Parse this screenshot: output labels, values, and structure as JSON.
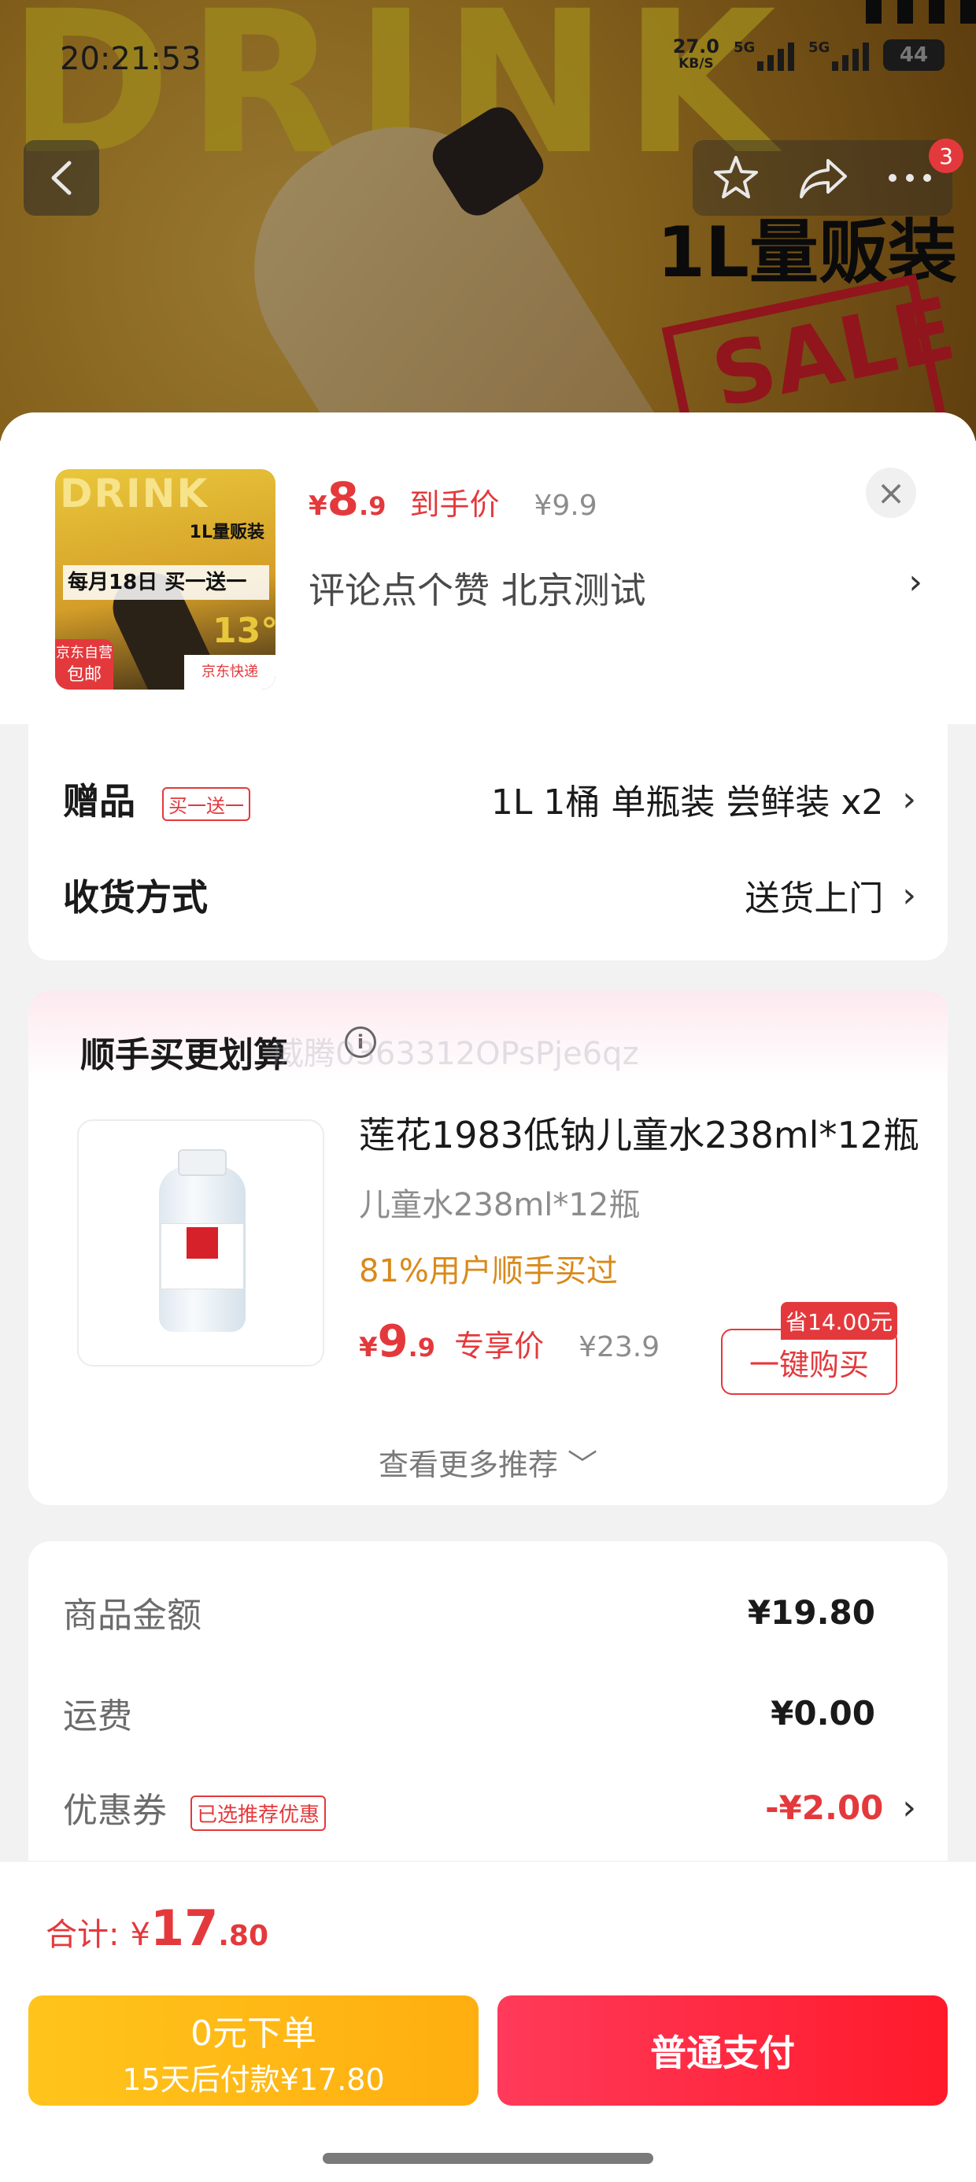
{
  "status_bar": {
    "time": "20:21:53",
    "speed_value": "27.0",
    "speed_unit": "KB/S",
    "network_1": "5G",
    "network_2": "5G",
    "battery": "44"
  },
  "hero": {
    "big_word": "DRINK",
    "tagline": "1L量贩装",
    "sale": "SALE",
    "notification_count": "3"
  },
  "product_header": {
    "thumbnail_text": {
      "brand": "DRINK",
      "size": "1L量贩装",
      "promo": "每月18日 买一送一",
      "degree": "13°",
      "free_shipping_line1": "京东自营",
      "free_shipping_line2": "包邮",
      "express": "京东快递"
    },
    "price_symbol": "¥",
    "price_integer": "8",
    "price_decimal": ".9",
    "price_label": "到手价",
    "original_price": "¥9.9",
    "subtitle": "评论点个赞  北京测试"
  },
  "options": {
    "gift_label": "赠品",
    "gift_tag": "买一送一",
    "gift_value": "1L 1桶 单瓶装 尝鲜装 x2",
    "delivery_label": "收货方式",
    "delivery_value": "送货上门"
  },
  "recommendation": {
    "title": "顺手买更划算",
    "watermark": "威腾0363312OPsPje6qz",
    "product_name": "莲花1983低钠儿童水238ml*12瓶",
    "product_spec": "儿童水238ml*12瓶",
    "bought_ratio": "81%用户顺手买过",
    "price_symbol": "¥",
    "price_integer": "9",
    "price_decimal": ".9",
    "price_label": "专享价",
    "original_price": "¥23.9",
    "save_badge": "省14.00元",
    "buy_button": "一键购买",
    "more_link": "查看更多推荐"
  },
  "summary": {
    "goods_label": "商品金额",
    "goods_value": "¥19.80",
    "shipping_label": "运费",
    "shipping_value": "¥0.00",
    "coupon_label": "优惠券",
    "coupon_tag": "已选推荐优惠",
    "coupon_value": "-¥2.00"
  },
  "footer": {
    "total_label": "合计:",
    "total_symbol": "¥",
    "total_integer": "17",
    "total_decimal": ".80",
    "zero_pay_line1": "0元下单",
    "zero_pay_line2": "15天后付款¥17.80",
    "pay_button": "普通支付"
  },
  "colors": {
    "accent_red": "#e4393c",
    "orange": "#d9891a",
    "zero_pay_yellow": "#ffbb14",
    "pay_red": "#ff2a40"
  }
}
